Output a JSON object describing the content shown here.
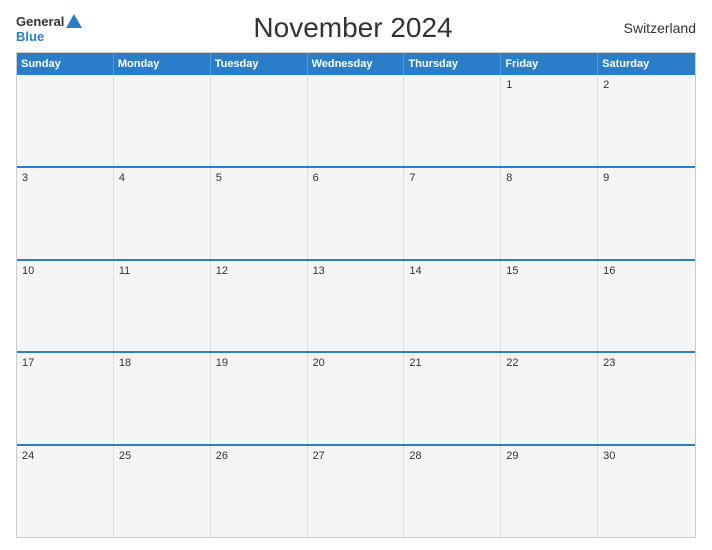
{
  "header": {
    "logo_general": "General",
    "logo_blue": "Blue",
    "title": "November 2024",
    "country": "Switzerland"
  },
  "days_of_week": [
    "Sunday",
    "Monday",
    "Tuesday",
    "Wednesday",
    "Thursday",
    "Friday",
    "Saturday"
  ],
  "weeks": [
    [
      {
        "number": "",
        "empty": true
      },
      {
        "number": "",
        "empty": true
      },
      {
        "number": "",
        "empty": true
      },
      {
        "number": "",
        "empty": true
      },
      {
        "number": "",
        "empty": true
      },
      {
        "number": "1",
        "empty": false
      },
      {
        "number": "2",
        "empty": false
      }
    ],
    [
      {
        "number": "3",
        "empty": false
      },
      {
        "number": "4",
        "empty": false
      },
      {
        "number": "5",
        "empty": false
      },
      {
        "number": "6",
        "empty": false
      },
      {
        "number": "7",
        "empty": false
      },
      {
        "number": "8",
        "empty": false
      },
      {
        "number": "9",
        "empty": false
      }
    ],
    [
      {
        "number": "10",
        "empty": false
      },
      {
        "number": "11",
        "empty": false
      },
      {
        "number": "12",
        "empty": false
      },
      {
        "number": "13",
        "empty": false
      },
      {
        "number": "14",
        "empty": false
      },
      {
        "number": "15",
        "empty": false
      },
      {
        "number": "16",
        "empty": false
      }
    ],
    [
      {
        "number": "17",
        "empty": false
      },
      {
        "number": "18",
        "empty": false
      },
      {
        "number": "19",
        "empty": false
      },
      {
        "number": "20",
        "empty": false
      },
      {
        "number": "21",
        "empty": false
      },
      {
        "number": "22",
        "empty": false
      },
      {
        "number": "23",
        "empty": false
      }
    ],
    [
      {
        "number": "24",
        "empty": false
      },
      {
        "number": "25",
        "empty": false
      },
      {
        "number": "26",
        "empty": false
      },
      {
        "number": "27",
        "empty": false
      },
      {
        "number": "28",
        "empty": false
      },
      {
        "number": "29",
        "empty": false
      },
      {
        "number": "30",
        "empty": false
      }
    ]
  ]
}
